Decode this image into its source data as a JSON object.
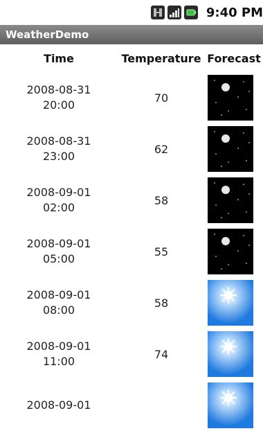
{
  "status_bar": {
    "time": "9:40 PM",
    "icons": [
      "network-icon",
      "signal-icon",
      "battery-icon"
    ]
  },
  "app": {
    "title": "WeatherDemo"
  },
  "table": {
    "headers": [
      "Time",
      "Temperature",
      "Forecast"
    ],
    "rows": [
      {
        "date": "2008-08-31",
        "time": "20:00",
        "temperature": "70",
        "forecast_icon": "night-moon-icon"
      },
      {
        "date": "2008-08-31",
        "time": "23:00",
        "temperature": "62",
        "forecast_icon": "night-moon-icon"
      },
      {
        "date": "2008-09-01",
        "time": "02:00",
        "temperature": "58",
        "forecast_icon": "night-moon-icon"
      },
      {
        "date": "2008-09-01",
        "time": "05:00",
        "temperature": "55",
        "forecast_icon": "night-moon-icon"
      },
      {
        "date": "2008-09-01",
        "time": "08:00",
        "temperature": "58",
        "forecast_icon": "sunny-icon"
      },
      {
        "date": "2008-09-01",
        "time": "11:00",
        "temperature": "74",
        "forecast_icon": "sunny-icon"
      },
      {
        "date": "2008-09-01",
        "time": "",
        "temperature": "",
        "forecast_icon": "sunny-icon"
      }
    ]
  },
  "colors": {
    "title_bar_top": "#8b8b8b",
    "title_bar_bottom": "#5f5f5f",
    "night_bg": "#000000",
    "day_sky": "#2f86e6"
  }
}
